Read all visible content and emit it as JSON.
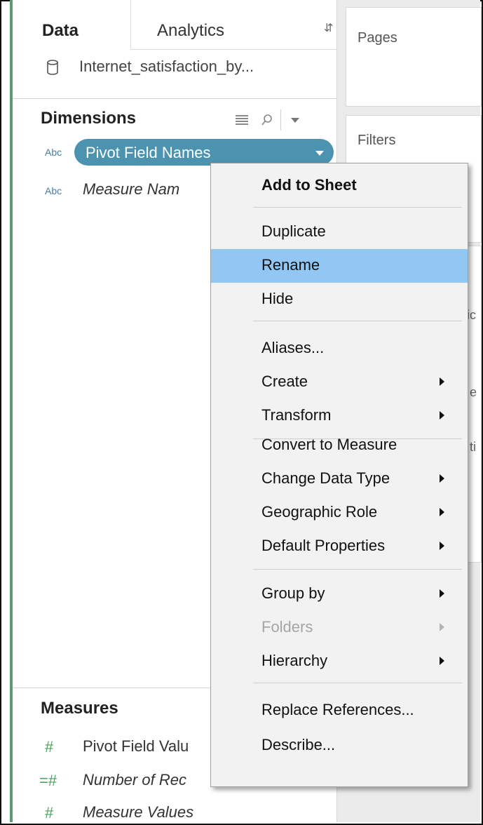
{
  "data_pane": {
    "tabs": {
      "data": "Data",
      "analytics": "Analytics"
    },
    "datasource": "Internet_satisfaction_by...",
    "dimensions": {
      "header": "Dimensions",
      "fields": [
        {
          "type": "Abc",
          "name": "Pivot Field Names",
          "selected": true
        },
        {
          "type": "Abc",
          "name": "Measure Nam"
        }
      ]
    },
    "measures": {
      "header": "Measures",
      "fields": [
        {
          "icon": "#",
          "name": "Pivot Field Valu"
        },
        {
          "icon": "=#",
          "name": "Number of Rec"
        },
        {
          "icon": "#",
          "name": "Measure Values"
        }
      ]
    }
  },
  "shelves": {
    "pages": "Pages",
    "filters": "Filters",
    "stubs": [
      "ic",
      "e",
      "ti"
    ]
  },
  "context_menu": {
    "items": [
      {
        "label": "Add to Sheet",
        "bold": true
      },
      {
        "label": "Duplicate"
      },
      {
        "label": "Rename",
        "highlighted": true
      },
      {
        "label": "Hide"
      },
      {
        "label": "Aliases..."
      },
      {
        "label": "Create",
        "submenu": true
      },
      {
        "label": "Transform",
        "submenu": true
      },
      {
        "label": "Convert to Measure"
      },
      {
        "label": "Change Data Type",
        "submenu": true
      },
      {
        "label": "Geographic Role",
        "submenu": true
      },
      {
        "label": "Default Properties",
        "submenu": true
      },
      {
        "label": "Group by",
        "submenu": true
      },
      {
        "label": "Folders",
        "submenu": true,
        "disabled": true
      },
      {
        "label": "Hierarchy",
        "submenu": true
      },
      {
        "label": "Replace References..."
      },
      {
        "label": "Describe..."
      }
    ]
  },
  "colors": {
    "pill": "#4b93ae",
    "highlight": "#92c7f4",
    "measure_icon": "#4ba35c",
    "dimension_icon": "#4a7da3"
  }
}
